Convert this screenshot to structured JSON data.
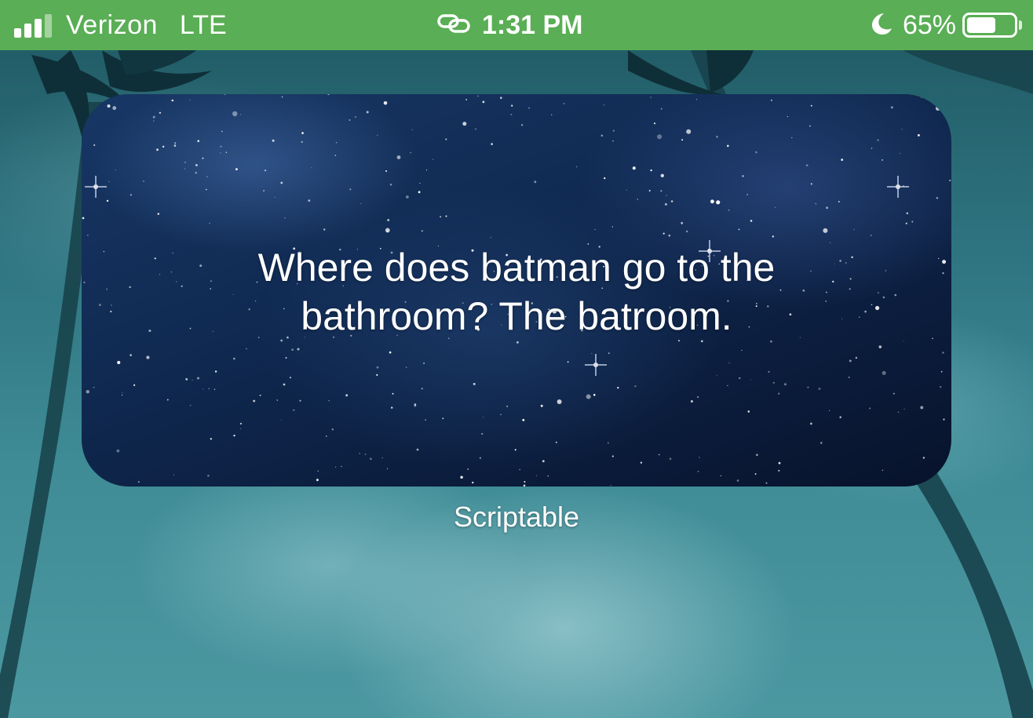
{
  "status_bar": {
    "carrier": "Verizon",
    "network": "LTE",
    "time": "1:31 PM",
    "battery_percent": "65%",
    "battery_level": 0.65,
    "signal_bars_filled": 3,
    "signal_bars_total": 4,
    "background_color": "#5aae55",
    "icons": [
      "signal-bars-icon",
      "link-icon",
      "moon-icon",
      "battery-icon"
    ]
  },
  "widget": {
    "joke": "Where does batman go to the bathroom? The batroom.",
    "app_label": "Scriptable"
  }
}
